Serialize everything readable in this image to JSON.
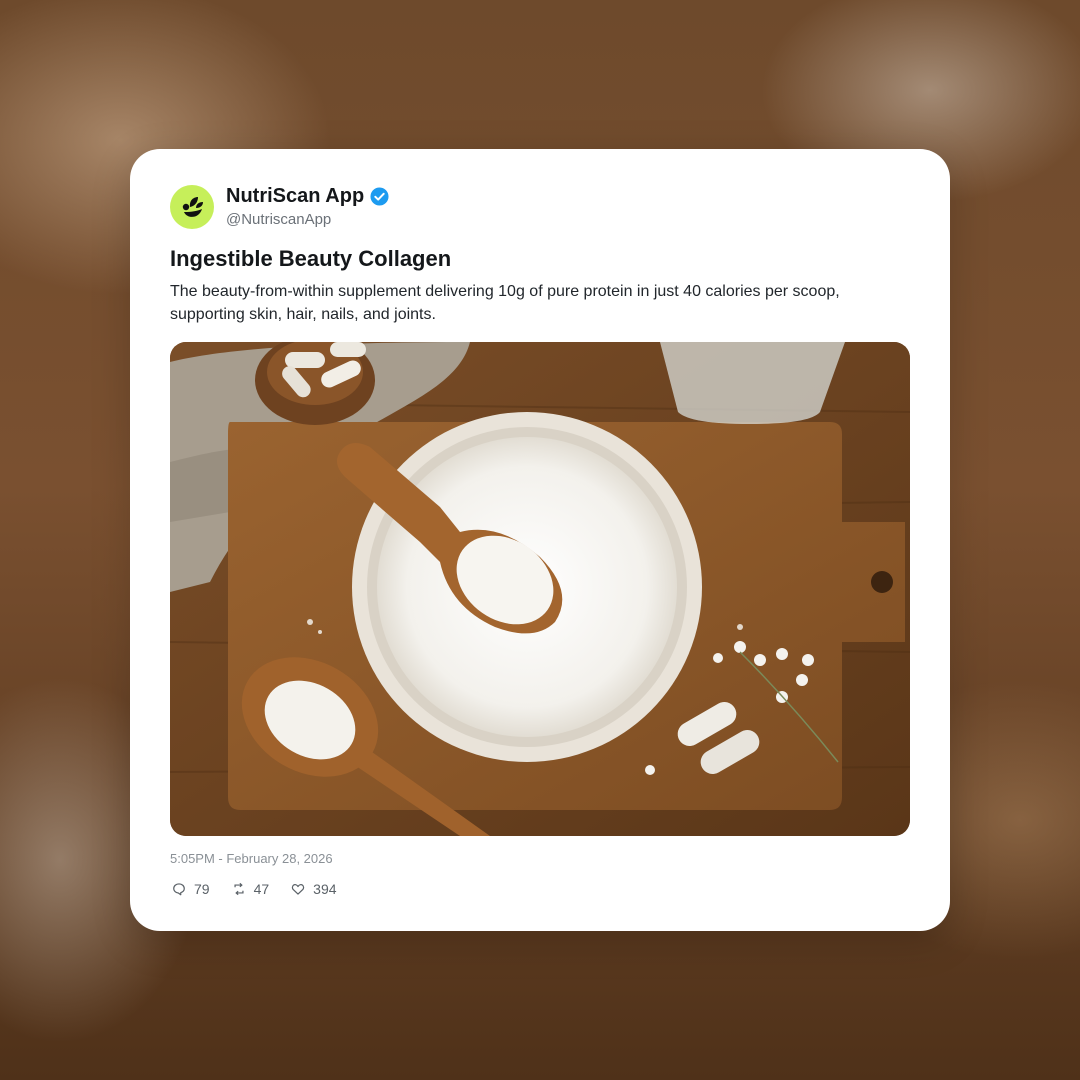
{
  "post": {
    "author": {
      "name": "NutriScan App",
      "handle": "@NutriscanApp",
      "avatar_icon": "leaf-logo-icon",
      "avatar_color": "#c6ef5a",
      "verified": true,
      "verified_color": "#1d9bf0"
    },
    "title": "Ingestible Beauty Collagen",
    "body": "The beauty-from-within supplement delivering 10g of pure protein in just 40 calories per scoop, supporting skin, hair, nails, and joints.",
    "image": {
      "subject": "collagen powder photo"
    },
    "timestamp": "5:05PM - February 28, 2026",
    "stats": {
      "replies": "79",
      "reposts": "47",
      "likes": "394"
    }
  }
}
